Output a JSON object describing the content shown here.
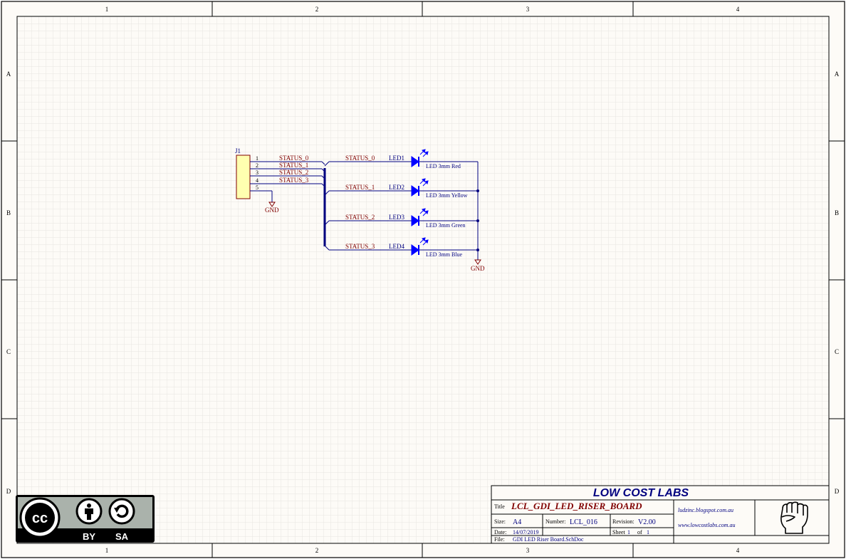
{
  "frame": {
    "columns": [
      "1",
      "2",
      "3",
      "4"
    ],
    "rows": [
      "A",
      "B",
      "C",
      "D"
    ]
  },
  "connector": {
    "designator": "J1",
    "pins": [
      "1",
      "2",
      "3",
      "4",
      "5"
    ],
    "nets": [
      "STATUS_0",
      "STATUS_1",
      "STATUS_2",
      "STATUS_3"
    ],
    "ground": "GND"
  },
  "leds": [
    {
      "net": "STATUS_0",
      "designator": "LED1",
      "value": "LED 3mm Red"
    },
    {
      "net": "STATUS_1",
      "designator": "LED2",
      "value": "LED 3mm Yellow"
    },
    {
      "net": "STATUS_2",
      "designator": "LED3",
      "value": "LED 3mm Green"
    },
    {
      "net": "STATUS_3",
      "designator": "LED4",
      "value": "LED 3mm Blue"
    }
  ],
  "led_ground": "GND",
  "title_block": {
    "company": "LOW COST LABS",
    "title_label": "Title",
    "title": "LCL_GDI_LED_RISER_BOARD",
    "size_label": "Size:",
    "size": "A4",
    "number_label": "Number:",
    "number": "LCL_016",
    "revision_label": "Revision:",
    "revision": "V2.00",
    "date_label": "Date:",
    "date": "14/07/2019",
    "sheet_label": "Sheet",
    "sheet": "1",
    "of_label": "of",
    "sheets": "1",
    "file_label": "File:",
    "file": "GDI LED Riser Board.SchDoc",
    "url1": "ludzinc.blogspot.com.au",
    "url2": "www.lowcostlabs.com.au"
  },
  "license": {
    "cc": "cc",
    "by": "BY",
    "sa": "SA"
  },
  "colors": {
    "paper": "#fdfbf7",
    "grid": "#e8e6e0",
    "wire": "#000080",
    "pin_red": "#800000",
    "led_blue": "#0000ff",
    "connector_fill": "#ffffb0",
    "connector_border": "#800000"
  }
}
